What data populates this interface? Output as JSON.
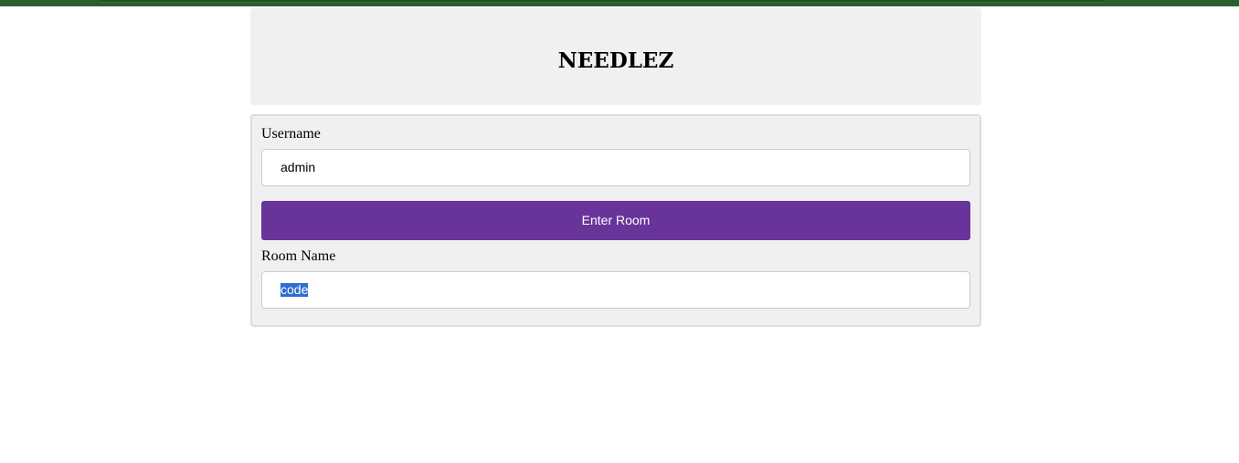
{
  "app": {
    "title": "NEEDLEZ"
  },
  "form": {
    "username_label": "Username",
    "username_value": "admin",
    "enter_button_label": "Enter Room",
    "room_label": "Room Name",
    "room_value": "code"
  },
  "colors": {
    "top_bar": "#2b5e2f",
    "button": "#693499",
    "panel_bg": "#f0f0f0",
    "selection": "#2f6cd1"
  }
}
